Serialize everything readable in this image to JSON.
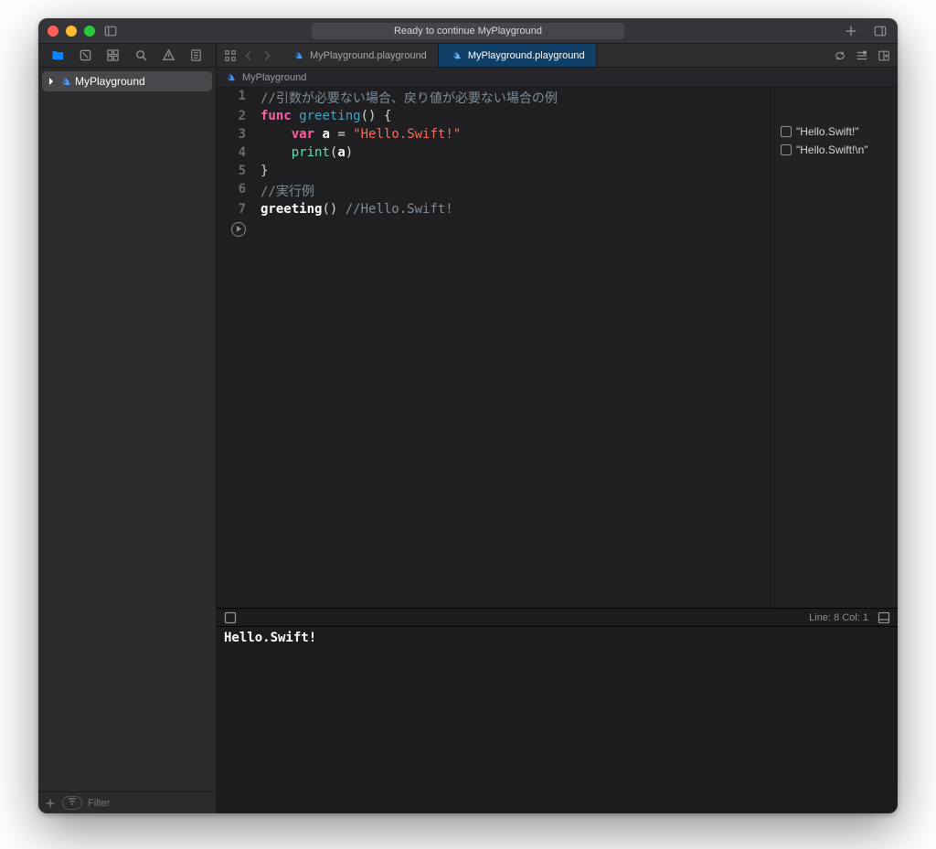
{
  "titlebar": {
    "status": "Ready to continue MyPlayground"
  },
  "navigator": {
    "project": "MyPlayground",
    "filter_placeholder": "Filter"
  },
  "tabs": {
    "t1": "MyPlayground.playground",
    "t2": "MyPlayground.playground"
  },
  "jumpbar": {
    "item": "MyPlayground"
  },
  "code": {
    "l1_comment": "//引数が必要ない場合、戻り値が必要ない場合の例",
    "l2_kw_func": "func",
    "l2_name": "greeting",
    "l2_tail": "() {",
    "l3_kw_var": "var",
    "l3_var": "a",
    "l3_eq": " = ",
    "l3_str": "\"Hello.Swift!\"",
    "l4_fn": "print",
    "l4_open": "(",
    "l4_arg": "a",
    "l4_close": ")",
    "l5_brace": "}",
    "l6_comment": "//実行例",
    "l7_call": "greeting",
    "l7_tail": "() ",
    "l7_comment": "//Hello.Swift!",
    "ln1": "1",
    "ln2": "2",
    "ln3": "3",
    "ln4": "4",
    "ln5": "5",
    "ln6": "6",
    "ln7": "7"
  },
  "results": {
    "r1": "\"Hello.Swift!\"",
    "r2": "\"Hello.Swift!\\n\""
  },
  "debug": {
    "cursor": "Line: 8  Col: 1",
    "console_out": "Hello.Swift!"
  }
}
